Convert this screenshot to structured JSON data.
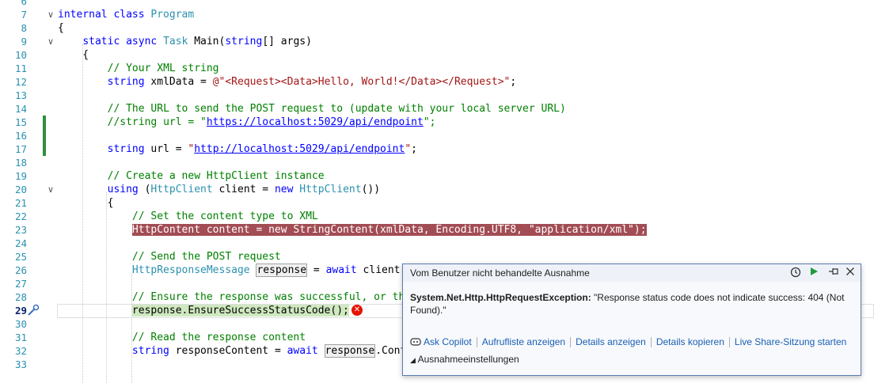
{
  "editor": {
    "current_line": 29,
    "lines": [
      {
        "n": 6,
        "tokens": []
      },
      {
        "n": 7,
        "fold": "∨",
        "tokens": [
          {
            "c": "kw",
            "t": "internal class "
          },
          {
            "c": "ty",
            "t": "Program"
          }
        ]
      },
      {
        "n": 8,
        "tokens": [
          {
            "c": "pl",
            "t": "{"
          }
        ]
      },
      {
        "n": 9,
        "fold": "∨",
        "tokens": [
          {
            "c": "pl",
            "t": "    "
          },
          {
            "c": "kw",
            "t": "static async "
          },
          {
            "c": "ty",
            "t": "Task "
          },
          {
            "c": "pl",
            "t": "Main("
          },
          {
            "c": "kw",
            "t": "string"
          },
          {
            "c": "pl",
            "t": "[] args)"
          }
        ]
      },
      {
        "n": 10,
        "tokens": [
          {
            "c": "pl",
            "t": "    {"
          }
        ]
      },
      {
        "n": 11,
        "tokens": [
          {
            "c": "pl",
            "t": "        "
          },
          {
            "c": "cm",
            "t": "// Your XML string"
          }
        ]
      },
      {
        "n": 12,
        "tokens": [
          {
            "c": "pl",
            "t": "        "
          },
          {
            "c": "kw",
            "t": "string "
          },
          {
            "c": "pl",
            "t": "xmlData = "
          },
          {
            "c": "st",
            "t": "@\"<Request><Data>Hello, World!</Data></Request>\""
          },
          {
            "c": "pl",
            "t": ";"
          }
        ]
      },
      {
        "n": 13,
        "tokens": []
      },
      {
        "n": 14,
        "tokens": [
          {
            "c": "pl",
            "t": "        "
          },
          {
            "c": "cm",
            "t": "// The URL to send the POST request to (update with your local server URL)"
          }
        ]
      },
      {
        "n": 15,
        "mod": true,
        "tokens": [
          {
            "c": "pl",
            "t": "        "
          },
          {
            "c": "cm",
            "t": "//string url = \""
          },
          {
            "c": "url",
            "t": "https://localhost:5029/api/endpoint"
          },
          {
            "c": "cm",
            "t": "\";"
          }
        ]
      },
      {
        "n": 16,
        "mod": true,
        "tokens": []
      },
      {
        "n": 17,
        "mod": true,
        "tokens": [
          {
            "c": "pl",
            "t": "        "
          },
          {
            "c": "kw",
            "t": "string "
          },
          {
            "c": "pl",
            "t": "url = "
          },
          {
            "c": "st",
            "t": "\""
          },
          {
            "c": "url",
            "t": "http://localhost:5029/api/endpoint"
          },
          {
            "c": "st",
            "t": "\""
          },
          {
            "c": "pl",
            "t": ";"
          }
        ]
      },
      {
        "n": 18,
        "tokens": []
      },
      {
        "n": 19,
        "tokens": [
          {
            "c": "pl",
            "t": "        "
          },
          {
            "c": "cm",
            "t": "// Create a new HttpClient instance"
          }
        ]
      },
      {
        "n": 20,
        "fold": "∨",
        "tokens": [
          {
            "c": "pl",
            "t": "        "
          },
          {
            "c": "kw",
            "t": "using "
          },
          {
            "c": "pl",
            "t": "("
          },
          {
            "c": "ty",
            "t": "HttpClient "
          },
          {
            "c": "pl",
            "t": "client = "
          },
          {
            "c": "kw",
            "t": "new "
          },
          {
            "c": "ty",
            "t": "HttpClient"
          },
          {
            "c": "pl",
            "t": "())"
          }
        ]
      },
      {
        "n": 21,
        "tokens": [
          {
            "c": "pl",
            "t": "        {"
          }
        ]
      },
      {
        "n": 22,
        "tokens": [
          {
            "c": "pl",
            "t": "            "
          },
          {
            "c": "cm",
            "t": "// Set the content type to XML"
          }
        ]
      },
      {
        "n": 23,
        "tokens": [
          {
            "c": "pl",
            "t": "            "
          },
          {
            "c": "bp",
            "t": "HttpContent content = new StringContent(xmlData, Encoding.UTF8, \"application/xml\");"
          }
        ]
      },
      {
        "n": 24,
        "tokens": []
      },
      {
        "n": 25,
        "tokens": [
          {
            "c": "pl",
            "t": "            "
          },
          {
            "c": "cm",
            "t": "// Send the POST request"
          }
        ]
      },
      {
        "n": 26,
        "tokens": [
          {
            "c": "pl",
            "t": "            "
          },
          {
            "c": "ty",
            "t": "HttpResponseMessage "
          },
          {
            "c": "hl",
            "t": "response"
          },
          {
            "c": "pl",
            "t": " = "
          },
          {
            "c": "kw",
            "t": "await "
          },
          {
            "c": "pl",
            "t": "client.P"
          }
        ]
      },
      {
        "n": 27,
        "tokens": []
      },
      {
        "n": 28,
        "tokens": [
          {
            "c": "pl",
            "t": "            "
          },
          {
            "c": "cm",
            "t": "// Ensure the response was successful, or thr"
          }
        ]
      },
      {
        "n": 29,
        "current": true,
        "tokens": [
          {
            "c": "pl",
            "t": "            "
          },
          {
            "c": "cur",
            "t": "response.EnsureSuccessStatusCode();"
          }
        ]
      },
      {
        "n": 30,
        "tokens": []
      },
      {
        "n": 31,
        "tokens": [
          {
            "c": "pl",
            "t": "            "
          },
          {
            "c": "cm",
            "t": "// Read the response content"
          }
        ]
      },
      {
        "n": 32,
        "tokens": [
          {
            "c": "pl",
            "t": "            "
          },
          {
            "c": "kw",
            "t": "string "
          },
          {
            "c": "pl",
            "t": "responseContent = "
          },
          {
            "c": "kw",
            "t": "await "
          },
          {
            "c": "ref",
            "t": "response"
          },
          {
            "c": "pl",
            "t": ".Conte"
          }
        ]
      },
      {
        "n": 33,
        "tokens": []
      }
    ]
  },
  "exception_popup": {
    "title": "Vom Benutzer nicht behandelte Ausnahme",
    "exception_type": "System.Net.Http.HttpRequestException:",
    "exception_message": " \"Response status code does not indicate success: 404 (Not Found).\"",
    "links": [
      "Ask Copilot",
      "Aufrufliste anzeigen",
      "Details anzeigen",
      "Details kopieren",
      "Live Share-Sitzung starten"
    ],
    "settings_label": "Ausnahmeeinstellungen",
    "icons": [
      "history-icon",
      "continue-icon",
      "pin-icon",
      "close-icon",
      "copilot-icon",
      "error-icon",
      "debug-pointer-icon"
    ]
  }
}
